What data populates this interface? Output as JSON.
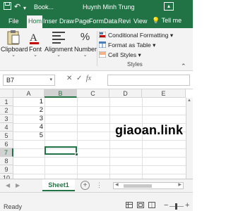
{
  "titlebar": {
    "save_icon": "save-icon",
    "undo_icon": "undo-icon",
    "redo_icon": "redo-icon",
    "customize_icon": "caret-down-icon",
    "title": "Book...",
    "user": "Huynh Minh Trung",
    "window_icon": "ribbon-display-options-icon"
  },
  "tabs": [
    "File",
    "Hom",
    "Inser",
    "Draw",
    "Page",
    "Form",
    "Data",
    "Revi",
    "View"
  ],
  "active_tab": "Hom",
  "tell_me": "Tell me",
  "ribbon": {
    "clipboard": "Clipboard",
    "font": "Font",
    "alignment": "Alignment",
    "number": "Number",
    "conditional_formatting": "Conditional Formatting",
    "format_as_table": "Format as Table",
    "cell_styles": "Cell Styles",
    "styles_group": "Styles",
    "number_glyph": "%"
  },
  "formula_bar": {
    "name_box": "B7",
    "cancel_glyph": "✕",
    "enter_glyph": "✓",
    "fx": "fx",
    "formula": ""
  },
  "grid": {
    "columns": [
      "A",
      "B",
      "C",
      "D",
      "E"
    ],
    "selected_column": "B",
    "rows": [
      "1",
      "2",
      "3",
      "4",
      "5",
      "6",
      "7",
      "8",
      "9",
      "10",
      "11"
    ],
    "selected_row": "7",
    "cells_A": [
      "1",
      "2",
      "3",
      "4",
      "5"
    ],
    "selected_cell": "B7",
    "watermark": "giaoan.link"
  },
  "sheets": {
    "active": "Sheet1",
    "add": "+",
    "more": "⋮"
  },
  "status": {
    "text": "Ready",
    "zoom_minus": "−",
    "zoom_plus": "+"
  },
  "colors": {
    "accent": "#217346",
    "ribbon_bg": "#f3f3f3",
    "gridline": "#e1e1e1"
  }
}
